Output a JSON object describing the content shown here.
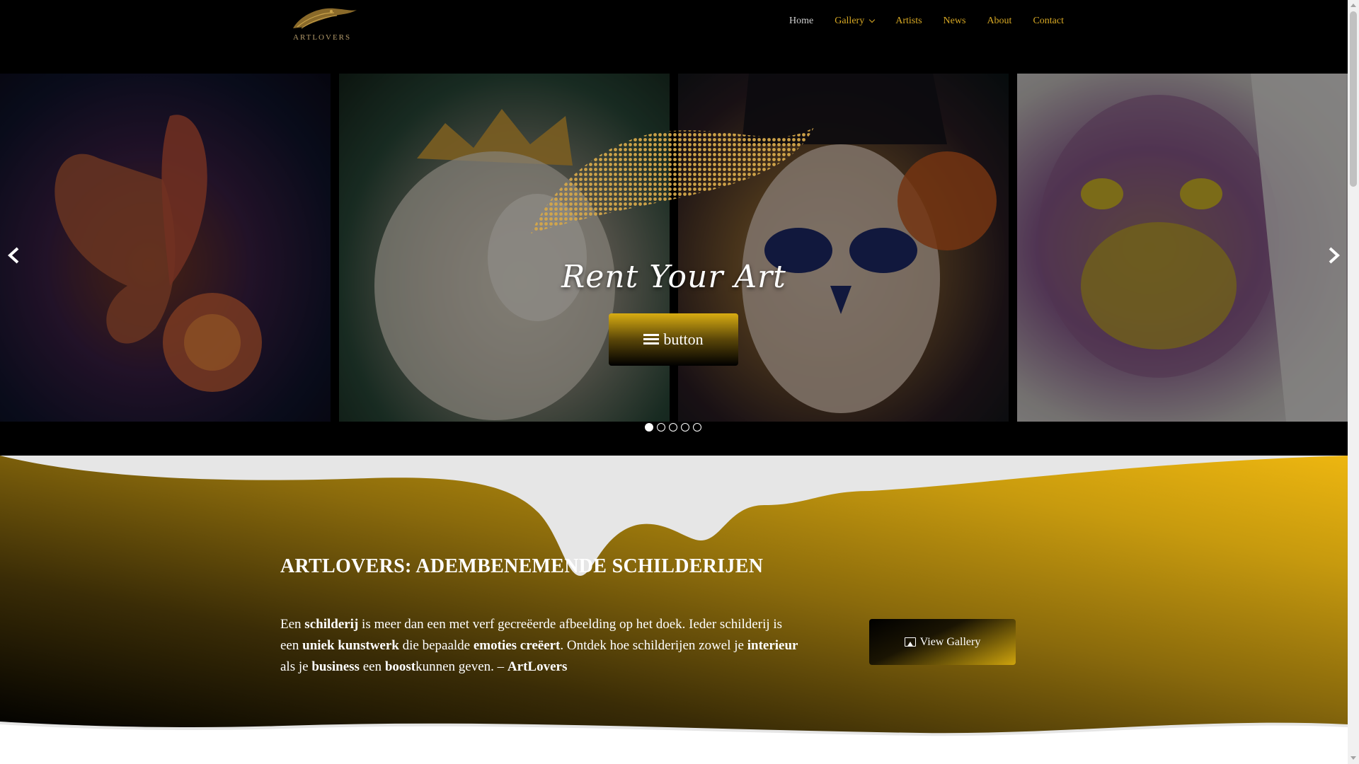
{
  "brand": {
    "logo_text": "ARTLOVERS"
  },
  "nav": {
    "items": [
      {
        "label": "Home"
      },
      {
        "label": "Gallery"
      },
      {
        "label": "Artists"
      },
      {
        "label": "News"
      },
      {
        "label": "About"
      },
      {
        "label": "Contact"
      }
    ]
  },
  "slider": {
    "title": "Rent Your Art",
    "button_label": "button",
    "button_icon": "bars-icon",
    "total_slides": 5,
    "active_slide": 1
  },
  "intro": {
    "heading": "ARTLOVERS: ADEMBENEMENDE SCHILDERIJEN",
    "paragraph_runs": [
      {
        "t": "Een ",
        "b": false
      },
      {
        "t": "schilderij",
        "b": true
      },
      {
        "t": " is meer dan een met verf gecreëerde afbeelding op het doek. Ieder schilderij is een ",
        "b": false
      },
      {
        "t": "uniek kunstwerk",
        "b": true
      },
      {
        "t": " die bepaalde ",
        "b": false
      },
      {
        "t": "emoties creëert",
        "b": true
      },
      {
        "t": ". Ontdek hoe schilderijen zowel je ",
        "b": false
      },
      {
        "t": "interieur",
        "b": true
      },
      {
        "t": " als je ",
        "b": false
      },
      {
        "t": "business",
        "b": true
      },
      {
        "t": " een ",
        "b": false
      },
      {
        "t": "boost",
        "b": true
      },
      {
        "t": "kunnen geven. – ",
        "b": false
      },
      {
        "t": "ArtLovers",
        "b": true
      }
    ],
    "gallery_button_label": "View Gallery",
    "gallery_button_icon": "image-icon"
  },
  "colors": {
    "accent_gold": "#d7a824",
    "gold_light": "#e8b310",
    "gold_dark": "#000000",
    "header_bg": "#000000"
  }
}
